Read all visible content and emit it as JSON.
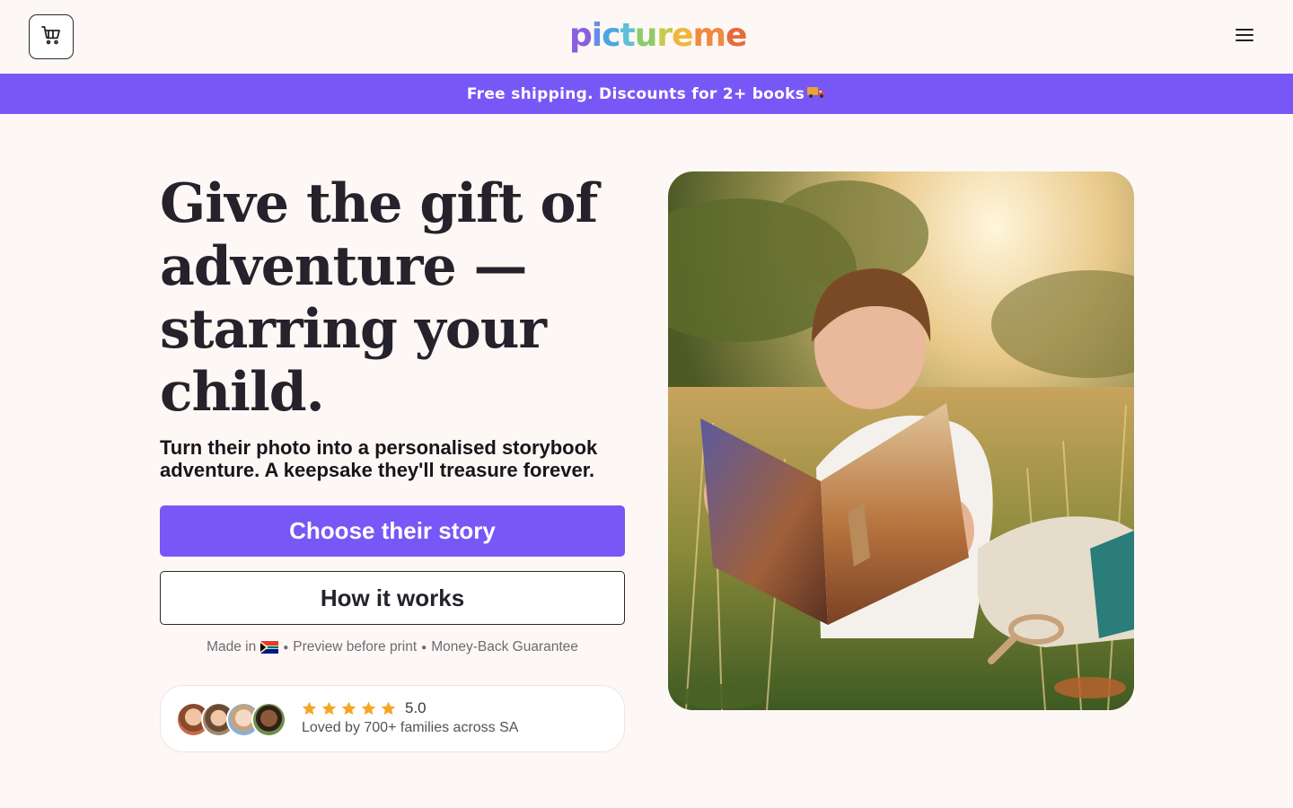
{
  "header": {
    "cart_icon": "cart-icon",
    "menu_icon": "hamburger-menu-icon",
    "logo": {
      "letters": [
        {
          "char": "p",
          "color": "#8a5fe0"
        },
        {
          "char": "i",
          "color": "#6a8ce8"
        },
        {
          "char": "c",
          "color": "#4aa6e0"
        },
        {
          "char": "t",
          "color": "#5dc0d8"
        },
        {
          "char": "u",
          "color": "#8ecb6a"
        },
        {
          "char": "r",
          "color": "#c9c94a"
        },
        {
          "char": "e",
          "color": "#f0b640"
        },
        {
          "char": "m",
          "color": "#f08a40"
        },
        {
          "char": "e",
          "color": "#e86a3c"
        }
      ]
    }
  },
  "banner": {
    "text": "Free shipping. Discounts for 2+ books",
    "icon": "delivery-truck-icon"
  },
  "hero": {
    "title": "Give the gift of adventure — starring your child.",
    "subtitle": "Turn their photo into a personalised storybook adventure. A keepsake they'll treasure forever.",
    "primary_cta": "Choose their story",
    "secondary_cta": "How it works",
    "trust": {
      "made_in": "Made in",
      "flag": "south-africa-flag-icon",
      "item2": "Preview before print",
      "item3": "Money-Back Guarantee"
    },
    "review": {
      "rating": "5.0",
      "stars": 5,
      "text": "Loved by 700+ families across SA"
    },
    "image_alt": "Child reading a personalised storybook in a sunlit meadow"
  },
  "colors": {
    "brand_purple": "#7758f6",
    "background": "#fdf8f5",
    "star": "#f5a623",
    "text_dark": "#26222c"
  }
}
